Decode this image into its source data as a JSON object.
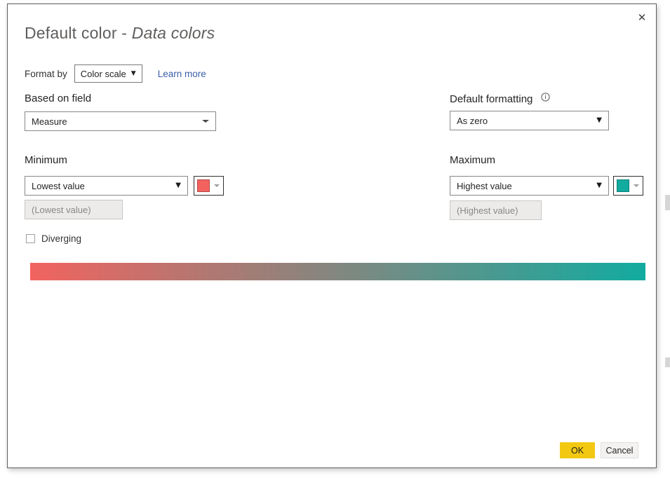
{
  "dialog": {
    "title_main": "Default color",
    "title_separator": " - ",
    "title_emphasis": "Data colors",
    "close_icon": "close-icon",
    "close_glyph": "✕"
  },
  "format_by": {
    "label": "Format by",
    "selected": "Color scale",
    "caret": "▼",
    "learn_more": "Learn more",
    "link_color": "#3b5ea8"
  },
  "based_on_field": {
    "label": "Based on field",
    "selected": "Measure"
  },
  "default_formatting": {
    "label": "Default formatting",
    "info_icon": "info-icon",
    "selected": "As zero",
    "caret": "▼"
  },
  "minimum": {
    "label": "Minimum",
    "selected": "Lowest value",
    "caret": "▼",
    "color": "#f2635f",
    "value_placeholder": "(Lowest value)"
  },
  "maximum": {
    "label": "Maximum",
    "selected": "Highest value",
    "caret": "▼",
    "color": "#12aba0",
    "value_placeholder": "(Highest value)"
  },
  "diverging": {
    "label": "Diverging",
    "checked": false
  },
  "gradient_preview": {
    "start_color": "#f2635f",
    "end_color": "#12aba0"
  },
  "footer": {
    "ok_label": "OK",
    "ok_color": "#f2c811",
    "cancel_label": "Cancel",
    "cancel_color": "#f3f2f1"
  }
}
